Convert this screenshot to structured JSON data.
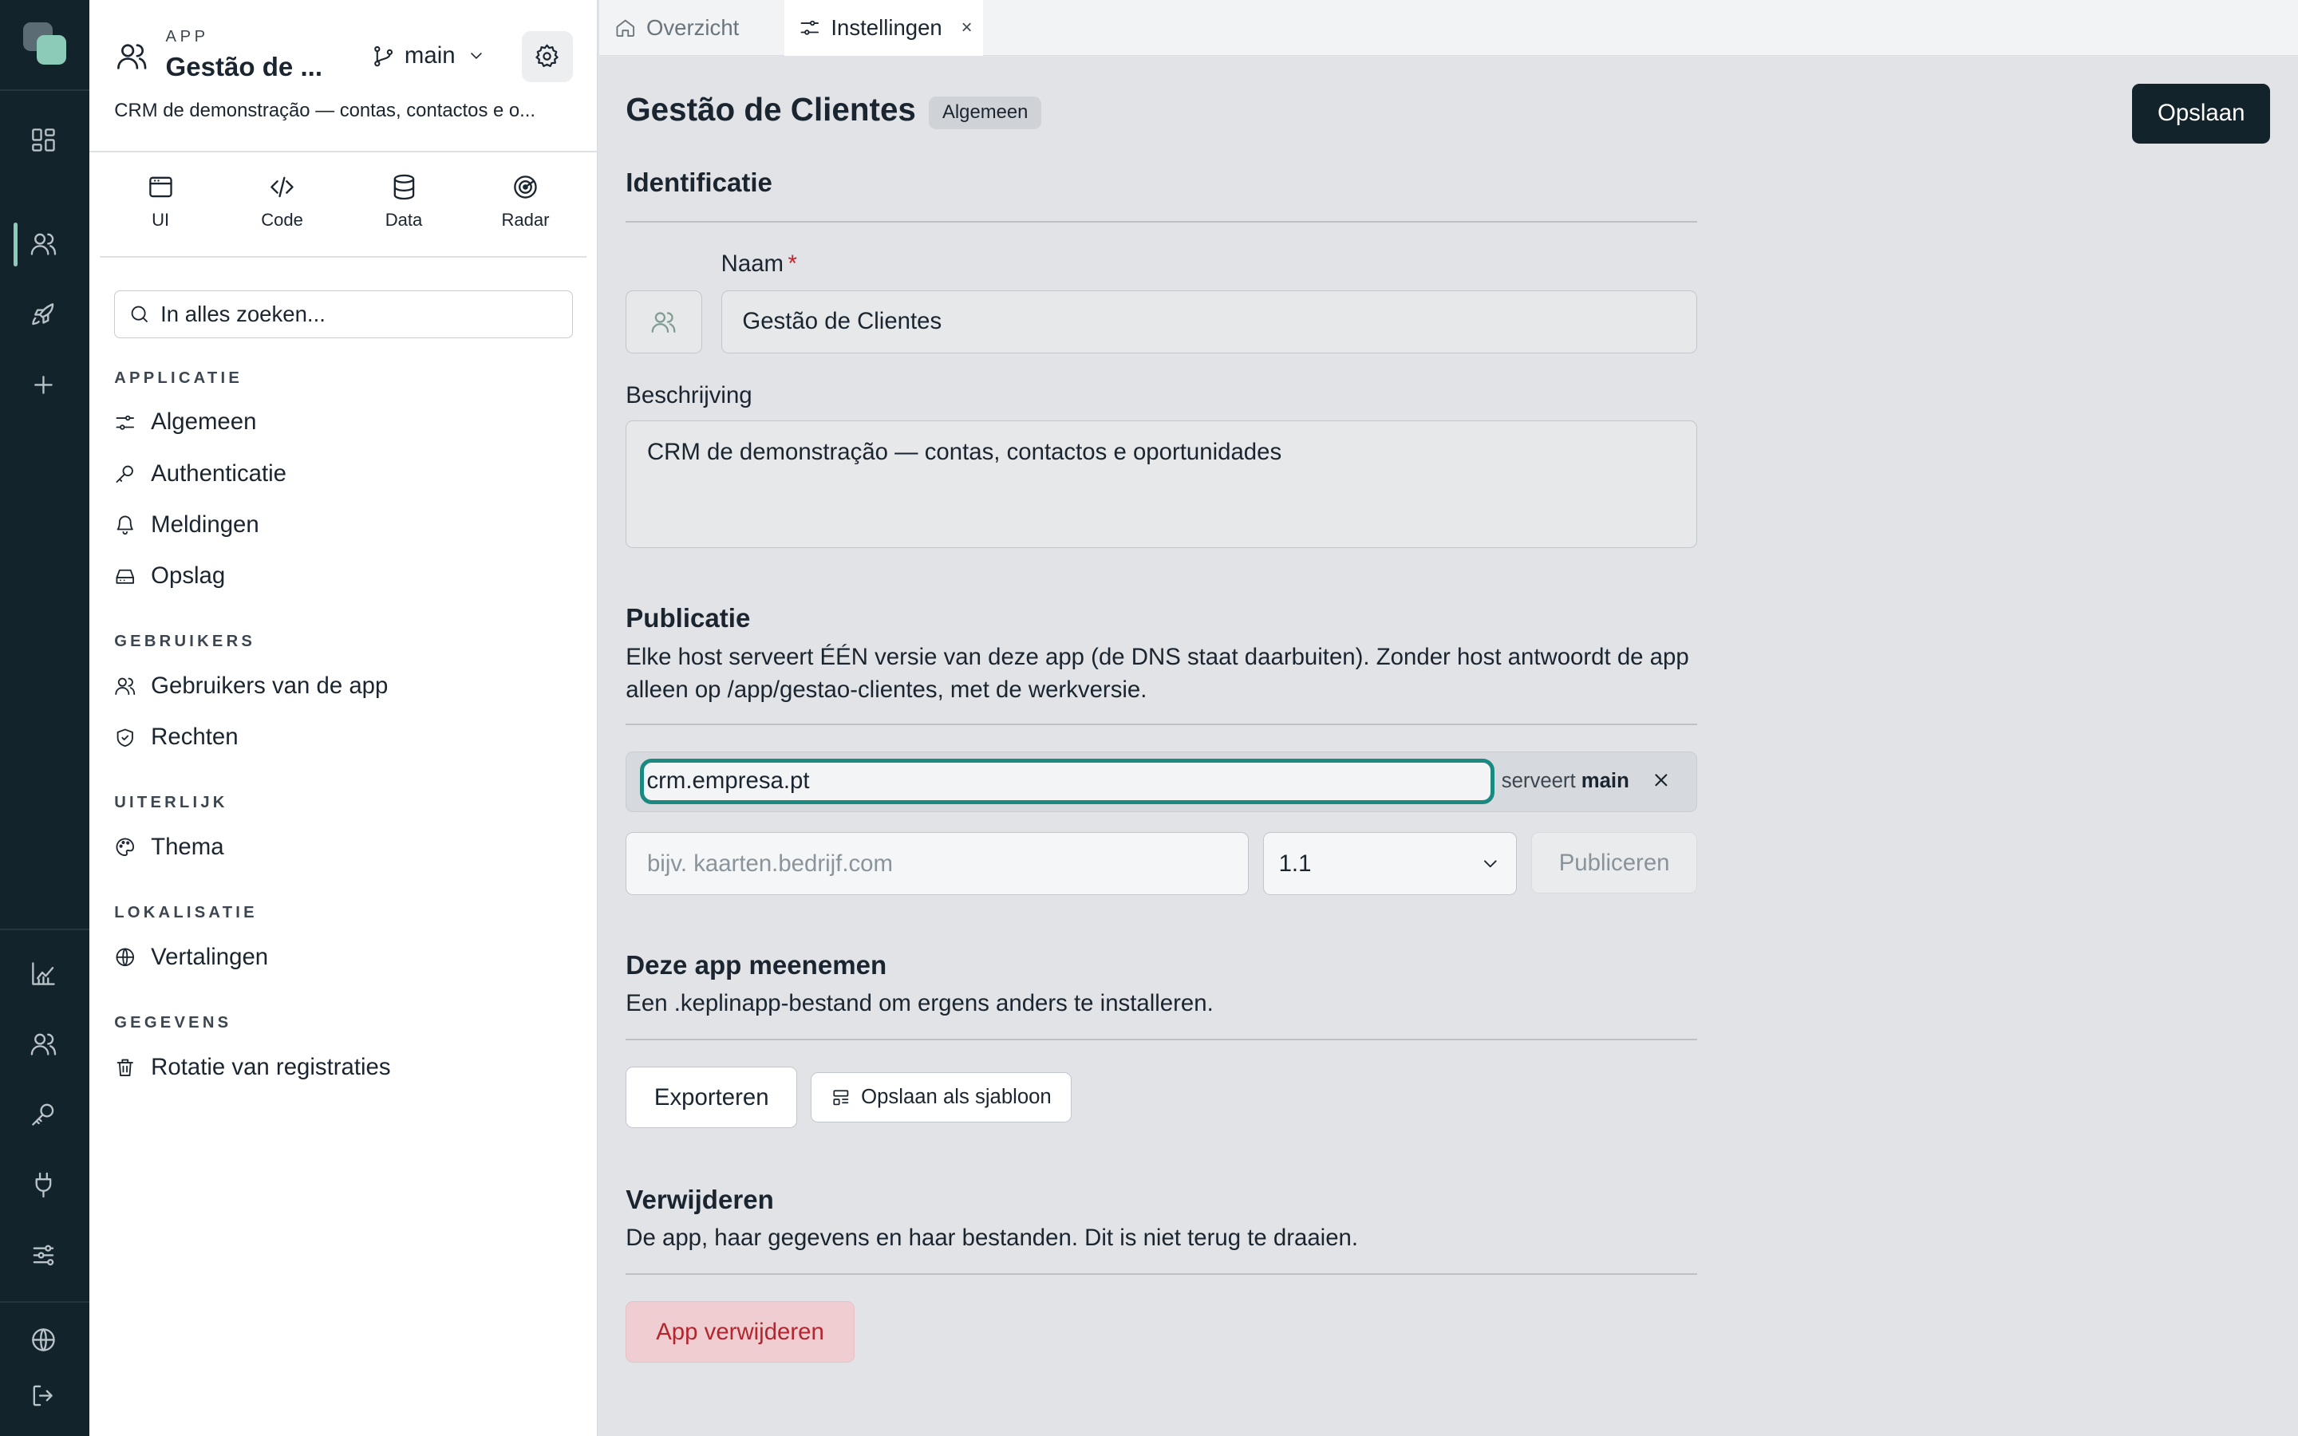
{
  "app": {
    "kicker": "APP",
    "name": "Gestão de Clientes",
    "name_display": "Gestão de ...",
    "branch": "main",
    "description": "CRM de demonstração — contas, contactos e oportunidades",
    "description_display": "CRM de demonstração — contas, contactos e o..."
  },
  "modes": [
    {
      "label": "UI",
      "icon": "window-icon"
    },
    {
      "label": "Code",
      "icon": "code-icon"
    },
    {
      "label": "Data",
      "icon": "database-icon"
    },
    {
      "label": "Radar",
      "icon": "radar-icon"
    }
  ],
  "search": {
    "placeholder": "In alles zoeken..."
  },
  "nav_groups": [
    {
      "title": "APPLICATIE",
      "items": [
        {
          "label": "Algemeen",
          "icon": "sliders-icon"
        },
        {
          "label": "Authenticatie",
          "icon": "key-icon"
        },
        {
          "label": "Meldingen",
          "icon": "bell-icon"
        },
        {
          "label": "Opslag",
          "icon": "drive-icon"
        }
      ]
    },
    {
      "title": "GEBRUIKERS",
      "items": [
        {
          "label": "Gebruikers van de app",
          "icon": "users-icon"
        },
        {
          "label": "Rechten",
          "icon": "shield-check-icon"
        }
      ]
    },
    {
      "title": "UITERLIJK",
      "items": [
        {
          "label": "Thema",
          "icon": "palette-icon"
        }
      ]
    },
    {
      "title": "LOKALISATIE",
      "items": [
        {
          "label": "Vertalingen",
          "icon": "globe-icon"
        }
      ]
    },
    {
      "title": "GEGEVENS",
      "items": [
        {
          "label": "Rotatie van registraties",
          "icon": "trash-icon"
        }
      ]
    }
  ],
  "tabs": [
    {
      "label": "Overzicht",
      "icon": "home-icon",
      "active": false
    },
    {
      "label": "Instellingen",
      "icon": "sliders-icon",
      "active": true,
      "close": "×"
    }
  ],
  "page": {
    "title": "Gestão de Clientes",
    "badge": "Algemeen",
    "save_label": "Opslaan"
  },
  "identification": {
    "heading": "Identificatie",
    "name_label": "Naam",
    "required_mark": "*",
    "name_value": "Gestão de Clientes",
    "description_label": "Beschrijving",
    "description_value": "CRM de demonstração — contas, contactos e oportunidades"
  },
  "publication": {
    "heading": "Publicatie",
    "text": "Elke host serveert ÉÉN versie van deze app (de DNS staat daarbuiten). Zonder host antwoordt de app alleen op /app/gestao-clientes, met de werkversie.",
    "host_value": "crm.empresa.pt",
    "serves_prefix": "serveert",
    "serves_branch": "main",
    "new_host_placeholder": "bijv. kaarten.bedrijf.com",
    "version_selected": "1.1",
    "publish_label": "Publiceren"
  },
  "export": {
    "heading": "Deze app meenemen",
    "text": "Een .keplinapp-bestand om ergens anders te installeren.",
    "export_label": "Exporteren",
    "template_label": "Opslaan als sjabloon"
  },
  "delete": {
    "heading": "Verwijderen",
    "text": "De app, haar gegevens en haar bestanden. Dit is niet terug te draaien.",
    "delete_label": "App verwijderen"
  },
  "colors": {
    "rail": "#13232c",
    "accent": "#8dcbb9",
    "focus": "#1a8a80",
    "danger": "#b3262e"
  }
}
